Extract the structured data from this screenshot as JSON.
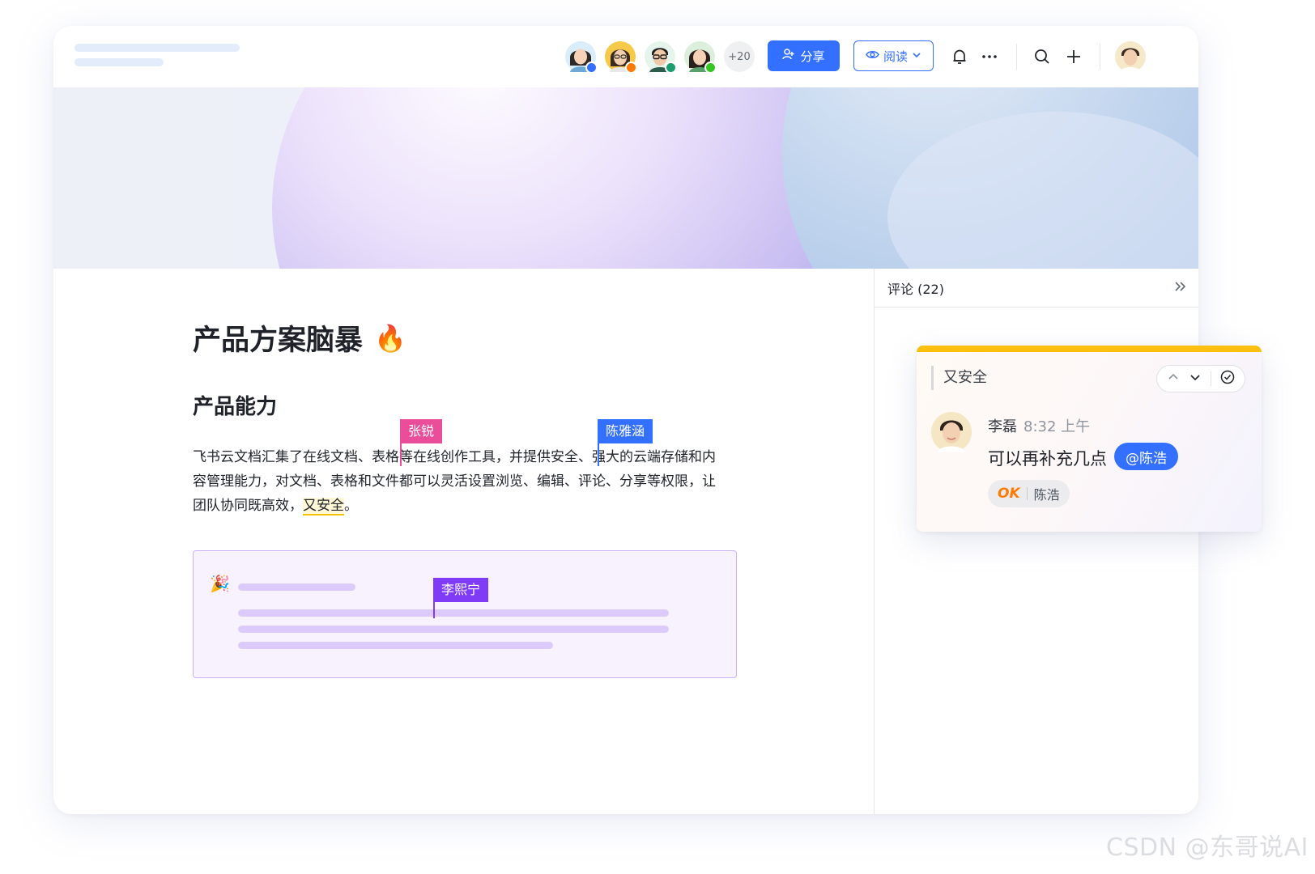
{
  "topbar": {
    "collaborators": [
      {
        "name": "collaborator-1",
        "status_color": "#3370ff"
      },
      {
        "name": "collaborator-2",
        "status_color": "#ff7a00"
      },
      {
        "name": "collaborator-3",
        "status_color": "#1a9e6f"
      },
      {
        "name": "collaborator-4",
        "status_color": "#34c724"
      }
    ],
    "more_count": "+20",
    "share_label": "分享",
    "read_label": "阅读"
  },
  "document": {
    "title": "产品方案脑暴",
    "title_emoji": "🔥",
    "heading": "产品能力",
    "paragraph_lines": [
      "飞书云文档汇集了在线文档、表格等在线创作工具，并提供安全、强大的云端存储和内",
      "容管理能力，对文档、表格和文件都可以灵活设置浏览、编辑、评论、分享等权限，让"
    ],
    "line3_prefix": "团队协同既高效，",
    "line3_highlight": "又安全",
    "line3_suffix": "。",
    "cursors": [
      {
        "user": "张锐",
        "color": "#ea4e9b"
      },
      {
        "user": "陈雅涵",
        "color": "#3370ff"
      },
      {
        "user": "李熙宁",
        "color": "#7f3bf5"
      }
    ],
    "callout_emoji": "🎉"
  },
  "comments": {
    "header": "评论 (22)",
    "card": {
      "quote": "又安全",
      "author": "李磊",
      "time": "8:32 上午",
      "text": "可以再补充几点",
      "mention": "@陈浩",
      "reaction_emoji": "OK",
      "reaction_user": "陈浩"
    }
  },
  "watermark": "CSDN @东哥说AI",
  "colors": {
    "accent": "#3370ff",
    "highlight_yellow": "#fbbf0f",
    "callout_purple": "#c9b3f5"
  }
}
